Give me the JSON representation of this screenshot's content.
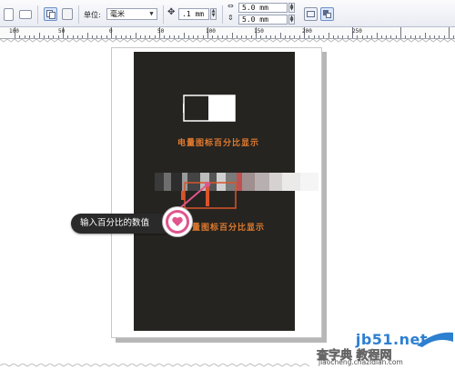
{
  "toolbar": {
    "unit_label": "单位:",
    "unit_value": "毫米",
    "nudge_value": ".1 mm",
    "dup_x": "5.0 mm",
    "dup_y": "5.0 mm"
  },
  "ruler": {
    "labels": [
      "100",
      "50",
      "0",
      "50",
      "100",
      "150",
      "200",
      "250"
    ]
  },
  "canvas": {
    "caption_top": "电量图标百分比显示",
    "caption_bottom": "电量图标百分比显示"
  },
  "callout": {
    "text": "输入百分比的数值"
  },
  "watermark": {
    "site": "jb51.net",
    "cn": "查字典 教程网",
    "url": "jiaocheng.chazidian.com"
  },
  "colors": {
    "canvas_dark": "#262420",
    "accent_orange": "#e07a2f",
    "callout_bg": "#2a2a2a",
    "heart_pink": "#e0558d",
    "watermark_blue": "#2d7fd0"
  }
}
